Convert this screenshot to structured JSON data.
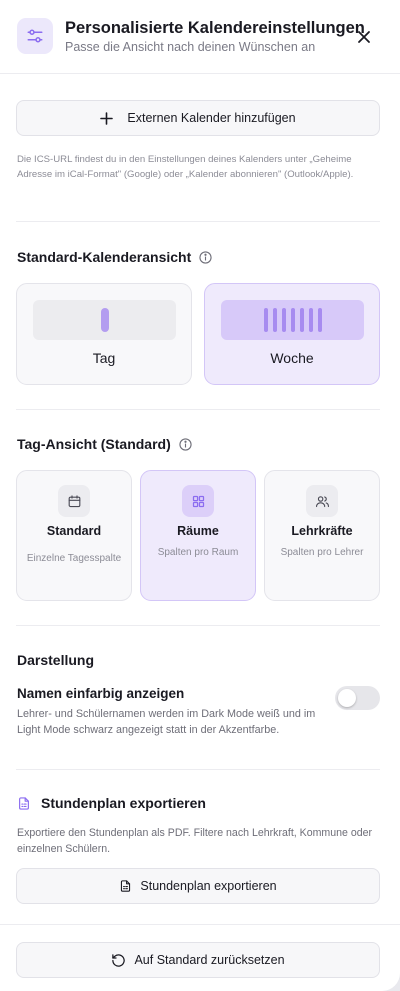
{
  "header": {
    "title": "Personalisierte Kalendereinstellungen",
    "subtitle": "Passe die Ansicht nach deinen Wünschen an",
    "icon": "sliders-icon",
    "close_icon": "close-icon"
  },
  "external": {
    "button_label": "Externen Kalender hinzufügen",
    "hint": "Die ICS-URL findest du in den Einstellungen deines Kalenders unter „Geheime Adresse im iCal-Format\" (Google) oder „Kalender abonnieren\" (Outlook/Apple)."
  },
  "default_view": {
    "title": "Standard-Kalenderansicht",
    "options": [
      {
        "label": "Tag",
        "selected": false
      },
      {
        "label": "Woche",
        "selected": true
      }
    ]
  },
  "day_view": {
    "title": "Tag-Ansicht (Standard)",
    "options": [
      {
        "title": "Standard",
        "desc": "Einzelne Tagesspalte",
        "icon": "calendar-icon",
        "selected": false
      },
      {
        "title": "Räume",
        "desc": "Spalten pro Raum",
        "icon": "grid-icon",
        "selected": true
      },
      {
        "title": "Lehrkräfte",
        "desc": "Spalten pro Lehrer",
        "icon": "users-icon",
        "selected": false
      }
    ]
  },
  "display": {
    "title": "Darstellung",
    "toggle_label": "Namen einfarbig anzeigen",
    "toggle_desc": "Lehrer- und Schülernamen werden im Dark Mode weiß und im Light Mode schwarz angezeigt statt in der Akzentfarbe.",
    "toggle_on": false
  },
  "export": {
    "title": "Stundenplan exportieren",
    "desc": "Exportiere den Stundenplan als PDF. Filtere nach Lehrkraft, Kommune oder einzelnen Schülern.",
    "button_label": "Stundenplan exportieren"
  },
  "footer": {
    "reset_label": "Auf Standard zurücksetzen"
  },
  "colors": {
    "accent": "#8b6cf0",
    "accent_light": "#efeafc",
    "border": "#e4e4ea"
  }
}
